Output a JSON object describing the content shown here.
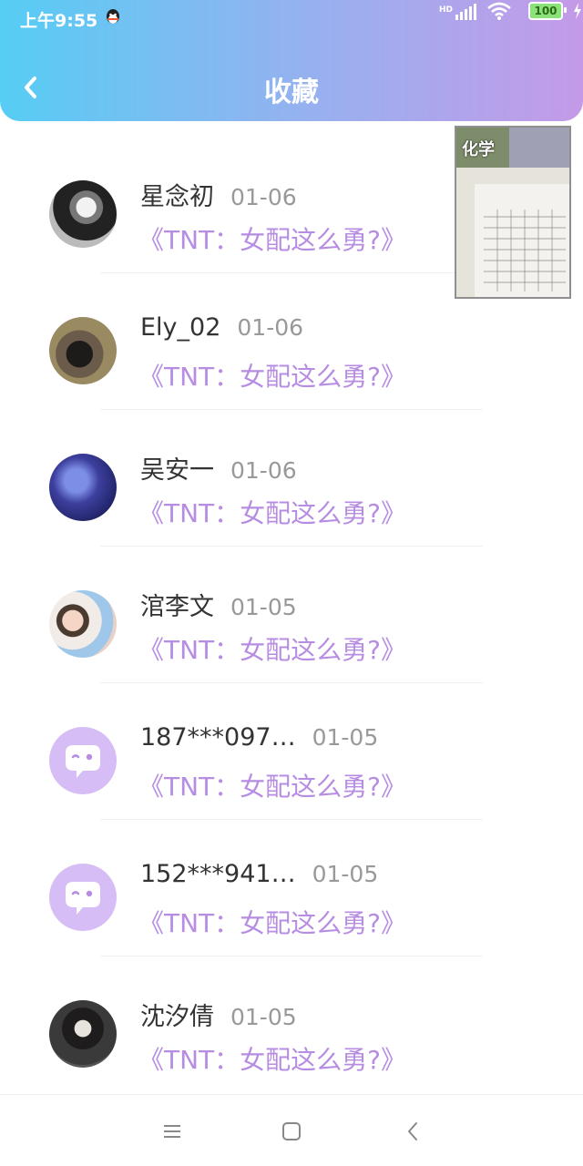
{
  "status_bar": {
    "time": "上午9:55",
    "hd": "HD",
    "battery": "100"
  },
  "header": {
    "title": "收藏"
  },
  "floating_card": {
    "label": "化学"
  },
  "items": [
    {
      "name": "星念初",
      "date": "01-06",
      "book": "《TNT：女配这么勇?》",
      "avatar": "photo-bw"
    },
    {
      "name": "Ely_02",
      "date": "01-06",
      "book": "《TNT：女配这么勇?》",
      "avatar": "photo-girl"
    },
    {
      "name": "吴安一",
      "date": "01-06",
      "book": "《TNT：女配这么勇?》",
      "avatar": "galaxy"
    },
    {
      "name": "涫李文",
      "date": "01-05",
      "book": "《TNT：女配这么勇?》",
      "avatar": "photo-couple"
    },
    {
      "name": "187***097…",
      "date": "01-05",
      "book": "《TNT：女配这么勇?》",
      "avatar": "default-chat"
    },
    {
      "name": "152***941…",
      "date": "01-05",
      "book": "《TNT：女配这么勇?》",
      "avatar": "default-chat"
    },
    {
      "name": "沈汐倩",
      "date": "01-05",
      "book": "《TNT：女配这么勇?》",
      "avatar": "photo-boy"
    }
  ],
  "colors": {
    "accent": "#b68de2",
    "header_start": "#56cdf4",
    "header_end": "#c49ae8"
  }
}
